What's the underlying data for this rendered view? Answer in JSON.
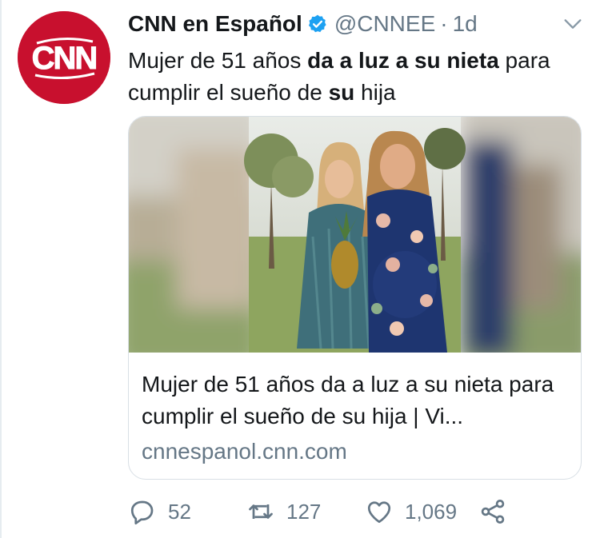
{
  "tweet": {
    "author_name": "CNN en Español",
    "handle": "@CNNEE",
    "separator": "·",
    "time": "1d",
    "text": {
      "part1": "Mujer de 51 años ",
      "bold1": "da a luz a su nieta",
      "part2": " para cumplir el sueño de ",
      "bold2": "su",
      "part3": " hija"
    },
    "avatar_logo_text": "CNN"
  },
  "card": {
    "title": "Mujer de 51 años da a luz a su nieta para cumplir el sueño de su hija | Vi...",
    "domain": "cnnespanol.cnn.com"
  },
  "actions": {
    "replies": "52",
    "retweets": "127",
    "likes": "1,069"
  },
  "colors": {
    "brand_red": "#c8102e",
    "verified_blue": "#1da1f2",
    "muted": "#657786",
    "text": "#14171a"
  },
  "icons": [
    "cnn-logo",
    "verified-badge-icon",
    "chevron-down-icon",
    "reply-icon",
    "retweet-icon",
    "like-icon",
    "share-icon"
  ]
}
